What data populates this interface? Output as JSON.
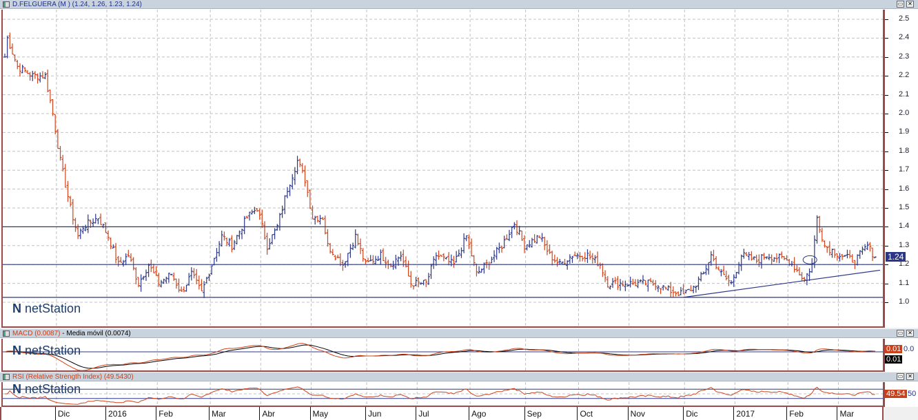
{
  "main": {
    "title": "D.FELGUERA (M ) (1.24, 1.26, 1.23, 1.24)",
    "last_price": "1.24",
    "logo": "netStation"
  },
  "macd": {
    "title": "MACD (0.0087)",
    "ma_title": "Media móvil (0.0074)",
    "macd_badge": "0.01",
    "signal_badge": "0.01",
    "axis_label": "0.0"
  },
  "rsi": {
    "title": "RSI (Relative Strength Index) (49.5430)",
    "badge": "49.54",
    "axis_label": "50"
  },
  "window_buttons": {
    "restore": "▭",
    "close": "✕"
  },
  "colors": {
    "up": "#2b3686",
    "down": "#d0441a",
    "line": "#2b3686",
    "grid": "#c0c0c0"
  },
  "chart_data": {
    "type": "ohlc",
    "title": "D.FELGUERA (M )",
    "ylim": [
      0.9,
      2.55
    ],
    "yticks": [
      "2.5",
      "2.4",
      "2.3",
      "2.2",
      "2.1",
      "2.0",
      "1.9",
      "1.8",
      "1.7",
      "1.6",
      "1.5",
      "1.4",
      "1.3",
      "1.2",
      "1.1",
      "1.0"
    ],
    "xticks": [
      {
        "day": 21,
        "label": "Dic"
      },
      {
        "day": 41,
        "label": "2016"
      },
      {
        "day": 61,
        "label": "Feb"
      },
      {
        "day": 82,
        "label": "Mar"
      },
      {
        "day": 102,
        "label": "Abr"
      },
      {
        "day": 122,
        "label": "May"
      },
      {
        "day": 144,
        "label": "Jun"
      },
      {
        "day": 164,
        "label": "Jul"
      },
      {
        "day": 185,
        "label": "Ago"
      },
      {
        "day": 207,
        "label": "Sep"
      },
      {
        "day": 228,
        "label": "Oct"
      },
      {
        "day": 248,
        "label": "Nov"
      },
      {
        "day": 270,
        "label": "Dic"
      },
      {
        "day": 290,
        "label": "2017"
      },
      {
        "day": 311,
        "label": "Feb"
      },
      {
        "day": 331,
        "label": "Mar"
      }
    ],
    "close_keypoints": [
      [
        0,
        2.3
      ],
      [
        1,
        2.4
      ],
      [
        5,
        2.25
      ],
      [
        11,
        2.2
      ],
      [
        16,
        2.2
      ],
      [
        19,
        2.0
      ],
      [
        22,
        1.75
      ],
      [
        26,
        1.5
      ],
      [
        29,
        1.35
      ],
      [
        31,
        1.4
      ],
      [
        37,
        1.45
      ],
      [
        41,
        1.35
      ],
      [
        45,
        1.2
      ],
      [
        49,
        1.25
      ],
      [
        53,
        1.1
      ],
      [
        57,
        1.2
      ],
      [
        61,
        1.1
      ],
      [
        66,
        1.15
      ],
      [
        70,
        1.05
      ],
      [
        74,
        1.15
      ],
      [
        78,
        1.05
      ],
      [
        82,
        1.2
      ],
      [
        86,
        1.35
      ],
      [
        90,
        1.3
      ],
      [
        96,
        1.45
      ],
      [
        100,
        1.5
      ],
      [
        104,
        1.3
      ],
      [
        108,
        1.4
      ],
      [
        112,
        1.6
      ],
      [
        116,
        1.75
      ],
      [
        119,
        1.65
      ],
      [
        122,
        1.45
      ],
      [
        126,
        1.45
      ],
      [
        128,
        1.3
      ],
      [
        134,
        1.2
      ],
      [
        139,
        1.35
      ],
      [
        143,
        1.2
      ],
      [
        149,
        1.25
      ],
      [
        153,
        1.2
      ],
      [
        157,
        1.25
      ],
      [
        161,
        1.1
      ],
      [
        167,
        1.1
      ],
      [
        171,
        1.25
      ],
      [
        178,
        1.2
      ],
      [
        183,
        1.35
      ],
      [
        187,
        1.15
      ],
      [
        191,
        1.2
      ],
      [
        197,
        1.3
      ],
      [
        202,
        1.42
      ],
      [
        206,
        1.3
      ],
      [
        212,
        1.35
      ],
      [
        216,
        1.25
      ],
      [
        220,
        1.2
      ],
      [
        225,
        1.25
      ],
      [
        231,
        1.25
      ],
      [
        236,
        1.2
      ],
      [
        239,
        1.1
      ],
      [
        245,
        1.1
      ],
      [
        251,
        1.1
      ],
      [
        258,
        1.1
      ],
      [
        262,
        1.07
      ],
      [
        269,
        1.04
      ],
      [
        273,
        1.08
      ],
      [
        277,
        1.15
      ],
      [
        280,
        1.25
      ],
      [
        284,
        1.15
      ],
      [
        288,
        1.1
      ],
      [
        292,
        1.25
      ],
      [
        298,
        1.22
      ],
      [
        302,
        1.25
      ],
      [
        311,
        1.22
      ],
      [
        317,
        1.12
      ],
      [
        320,
        1.2
      ],
      [
        322,
        1.45
      ],
      [
        325,
        1.3
      ],
      [
        331,
        1.25
      ],
      [
        337,
        1.22
      ],
      [
        342,
        1.3
      ],
      [
        345,
        1.24
      ]
    ],
    "hlines": [
      1.4,
      1.2,
      1.026
    ],
    "trendline": [
      [
        269,
        1.026
      ],
      [
        347,
        1.17
      ]
    ],
    "macd_zero": 0.0,
    "rsi_levels": [
      70,
      50,
      30
    ]
  }
}
